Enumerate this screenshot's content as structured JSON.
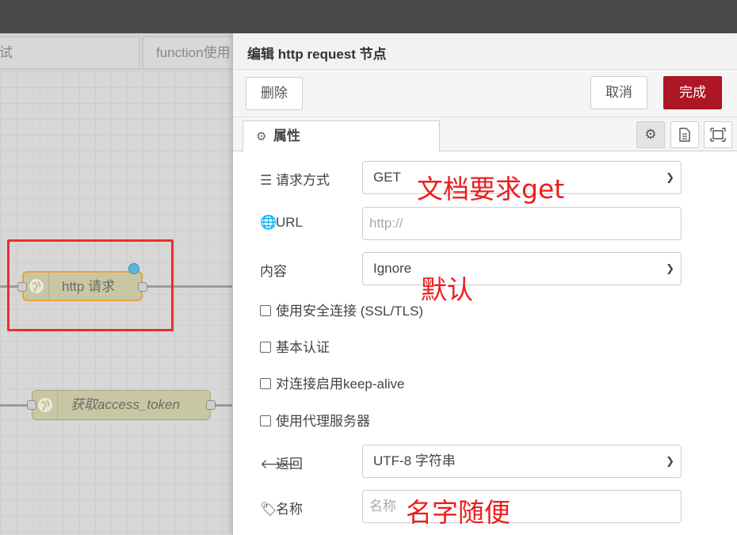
{
  "canvas": {
    "tabs": [
      {
        "label": "试"
      },
      {
        "label": "function使用"
      }
    ],
    "nodes": [
      {
        "label": "http 请求"
      },
      {
        "label": "获取access_token"
      }
    ]
  },
  "editor": {
    "title": "编辑 http request 节点",
    "buttons": {
      "delete": "删除",
      "cancel": "取消",
      "done": "完成"
    },
    "tab_label": "属性",
    "fields": {
      "method": {
        "label": "请求方式",
        "value": "GET"
      },
      "url": {
        "label": "URL",
        "placeholder": "http://"
      },
      "payload": {
        "label": "内容",
        "value": "Ignore"
      },
      "return": {
        "label": "返回",
        "value": "UTF-8 字符串"
      },
      "name": {
        "label": "名称",
        "placeholder": "名称"
      }
    },
    "checkboxes": [
      {
        "label": "使用安全连接 (SSL/TLS)",
        "checked": false
      },
      {
        "label": "基本认证",
        "checked": false
      },
      {
        "label": "对连接启用keep-alive",
        "checked": false
      },
      {
        "label": "使用代理服务器",
        "checked": false
      }
    ]
  },
  "annotations": {
    "method_note": "文档要求get",
    "payload_note": "默认",
    "name_note": "名字随便"
  },
  "colors": {
    "done_button": "#ad1625",
    "annotation": "#ee1c1c",
    "node_fill": "#c9c7a3",
    "status_dot": "#5bb7d9"
  },
  "icons": {
    "properties_tab": "gear-icon",
    "settings_button": "gear-icon",
    "description_button": "document-icon",
    "appearance_button": "frame-icon",
    "method": "server-icon",
    "url": "globe-icon",
    "return": "arrow-left-icon",
    "name": "tag-icon",
    "node": "globe-icon"
  }
}
